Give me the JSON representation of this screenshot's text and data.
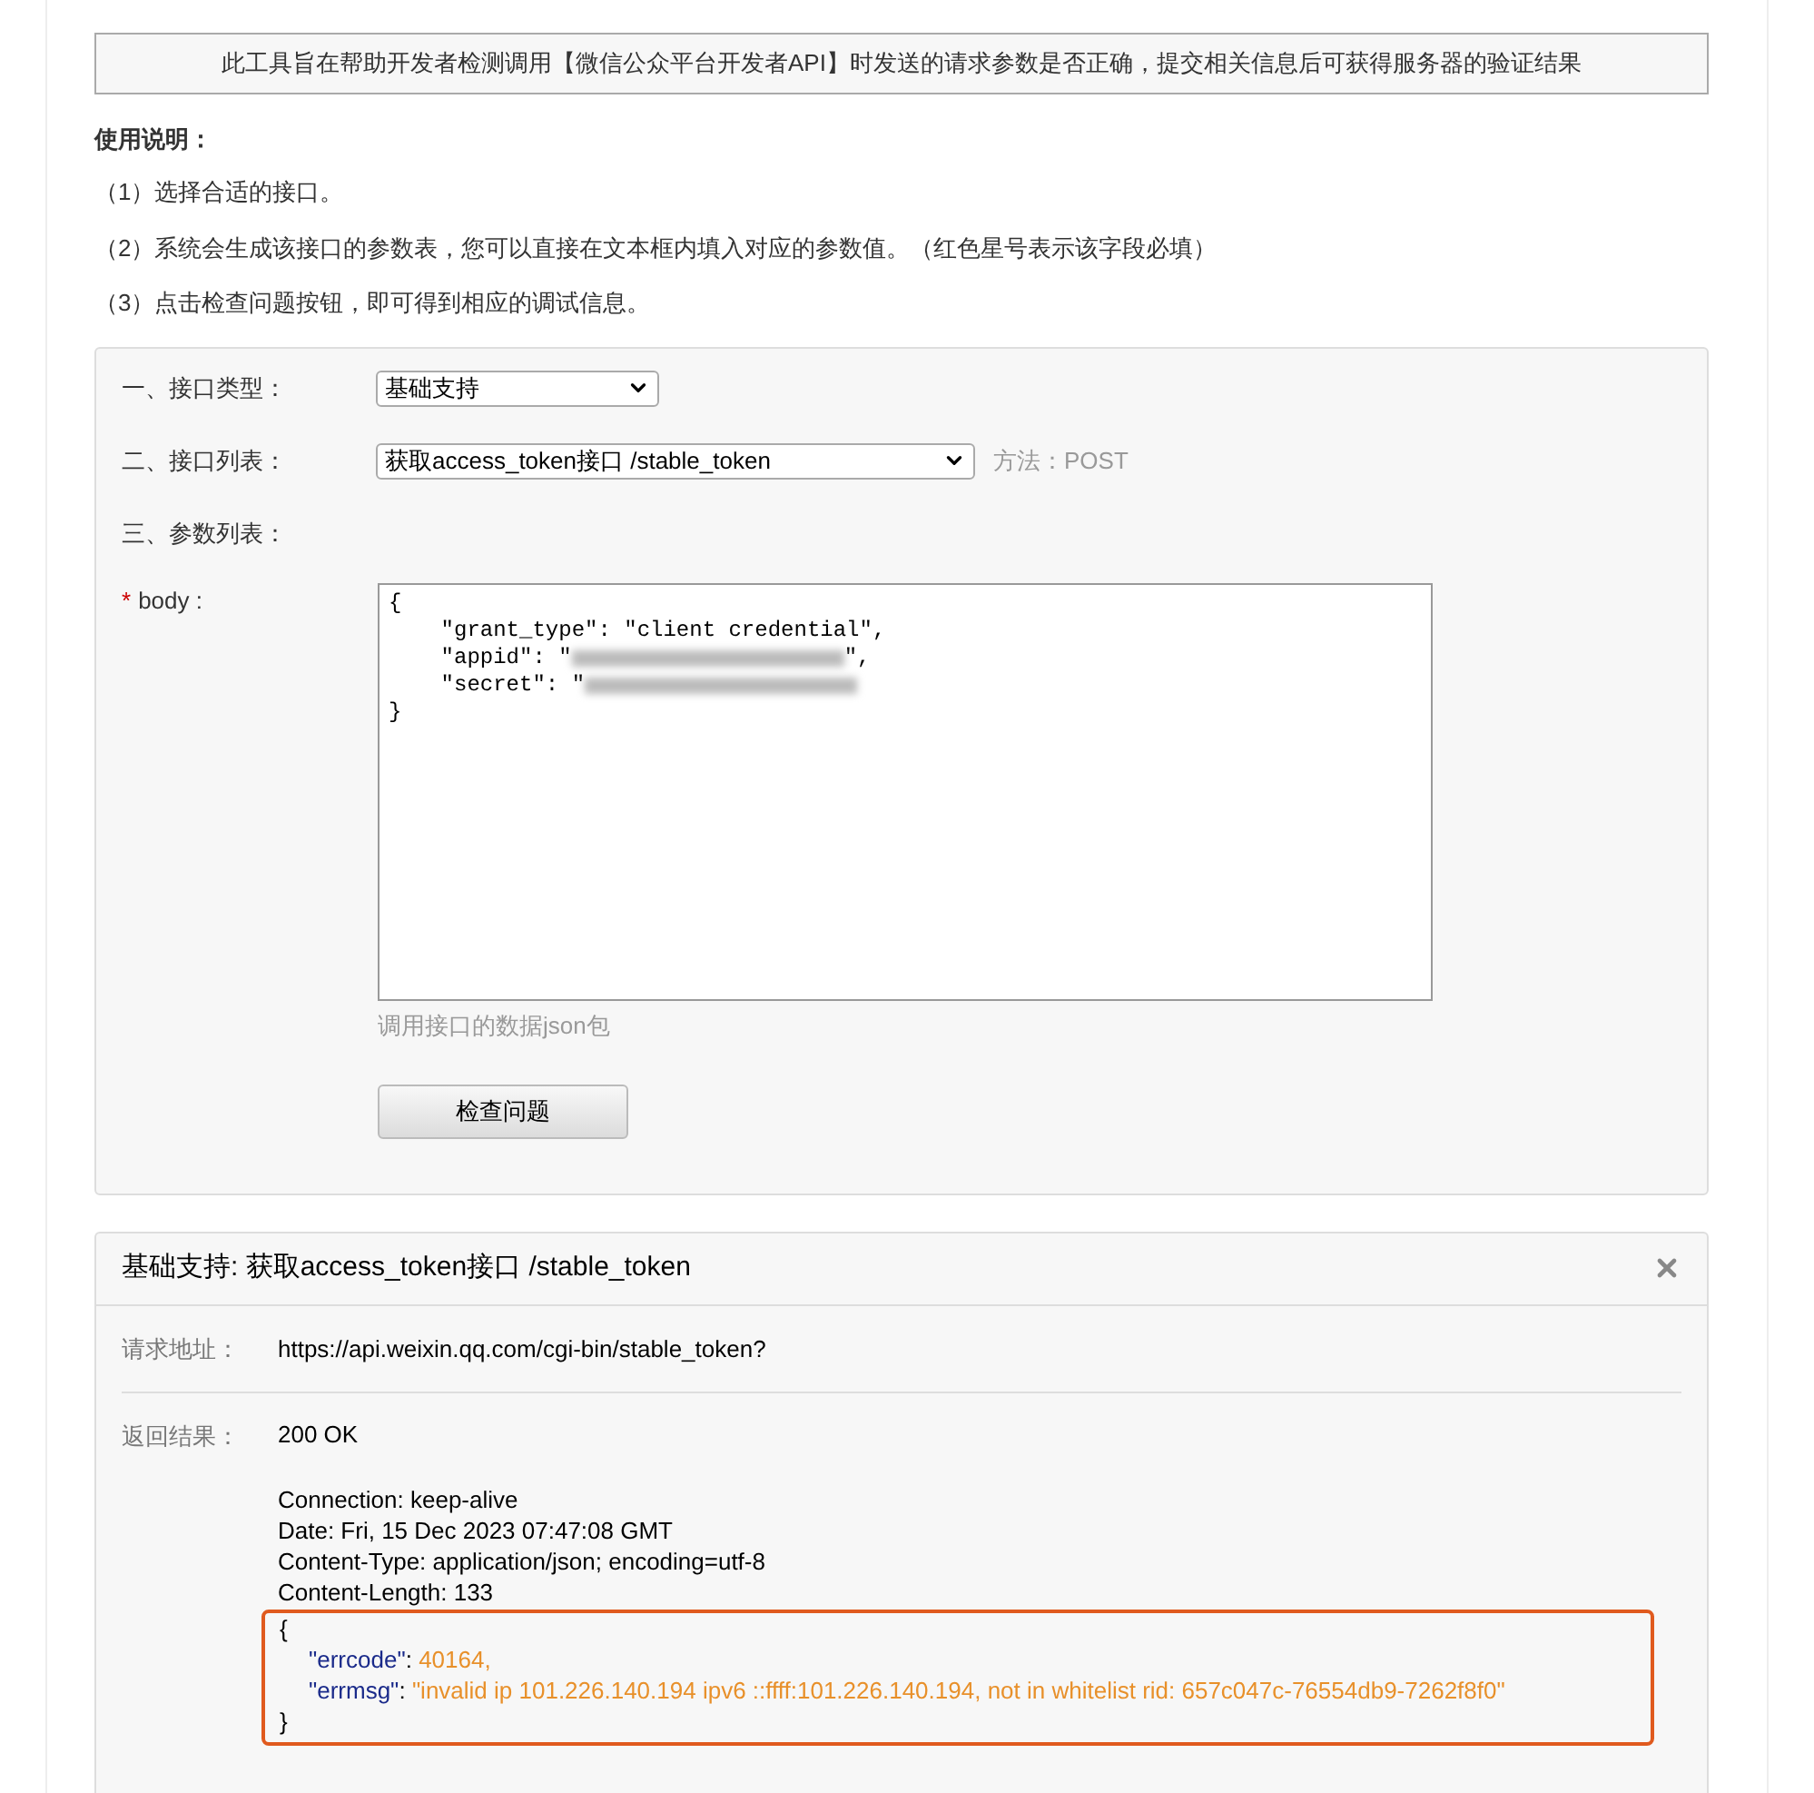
{
  "notice": "此工具旨在帮助开发者检测调用【微信公众平台开发者API】时发送的请求参数是否正确，提交相关信息后可获得服务器的验证结果",
  "instructions": {
    "title": "使用说明：",
    "steps": [
      "（1）选择合适的接口。",
      "（2）系统会生成该接口的参数表，您可以直接在文本框内填入对应的参数值。（红色星号表示该字段必填）",
      "（3）点击检查问题按钮，即可得到相应的调试信息。"
    ]
  },
  "form": {
    "interface_type": {
      "label": "一、接口类型：",
      "value": "基础支持"
    },
    "interface_list": {
      "label": "二、接口列表：",
      "value": "获取access_token接口 /stable_token",
      "method": "方法：POST"
    },
    "params_label": "三、参数列表：",
    "params": [
      {
        "name": "body :",
        "required": true,
        "mark": "*",
        "hint": "调用接口的数据json包",
        "value_lines": [
          {
            "text": "{",
            "redacted": false
          },
          {
            "text": "    \"grant_type\": \"client credential\",",
            "redacted": false
          },
          {
            "text": "    \"appid\": \"",
            "redacted": true,
            "after": "\","
          },
          {
            "text": "    \"secret\": \"",
            "redacted": true
          },
          {
            "text": "}",
            "redacted": false
          }
        ]
      }
    ],
    "submit": "检查问题"
  },
  "result": {
    "title": "基础支持: 获取access_token接口 /stable_token",
    "rows": [
      {
        "label": "请求地址：",
        "value": "https://api.weixin.qq.com/cgi-bin/stable_token?"
      }
    ],
    "response": {
      "label": "返回结果：",
      "status": "200 OK",
      "headers": [
        "Connection: keep-alive",
        "Date: Fri, 15 Dec 2023 07:47:08 GMT",
        "Content-Type: application/json; encoding=utf-8",
        "Content-Length: 133"
      ],
      "body": {
        "highlighted": true,
        "open": "{",
        "close": "}",
        "entries": [
          {
            "key": "\"errcode\"",
            "sep": ":",
            "value": "40164,"
          },
          {
            "key": "\"errmsg\"",
            "sep": ":",
            "value": "\"invalid ip 101.226.140.194 ipv6 ::ffff:101.226.140.194, not in whitelist rid: 657c047c-76554db9-7262f8f0\""
          }
        ]
      }
    }
  }
}
